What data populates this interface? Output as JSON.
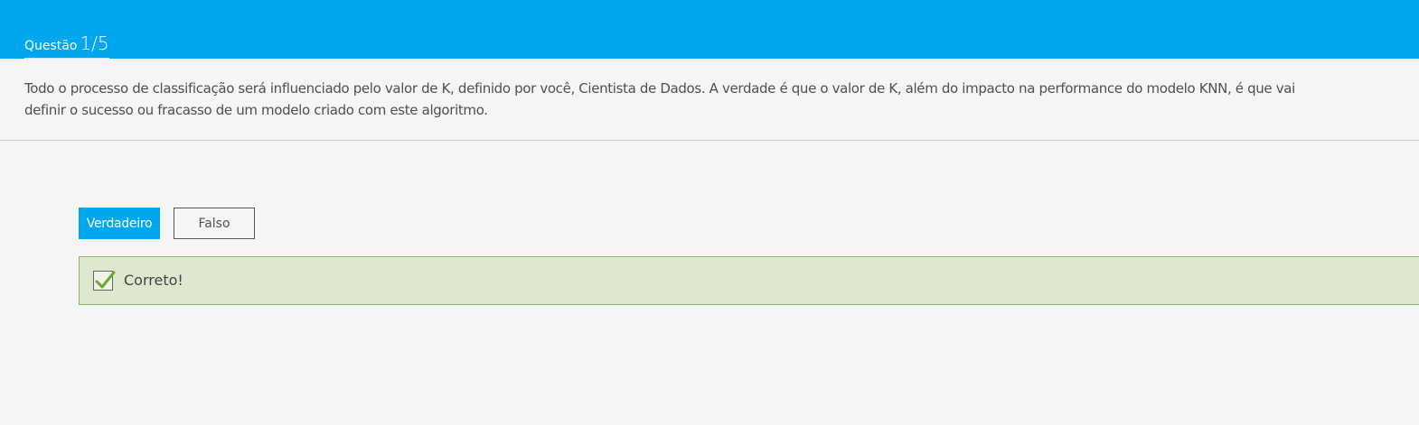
{
  "header": {
    "label": "Questão",
    "count": "1/5",
    "background_color": "#00a6ee"
  },
  "question": {
    "text": "Todo o processo de classificação será influenciado pelo valor de K, definido por você, Cientista de Dados. A verdade é que o valor de K, além do impacto na performance do modelo KNN, é que vai definir o sucesso ou fracasso de um modelo criado com este algoritmo."
  },
  "options": {
    "true_label": "Verdadeiro",
    "false_label": "Falso",
    "selected": "Verdadeiro"
  },
  "feedback": {
    "text": "Correto!",
    "icon": "checkmark-icon",
    "background_color": "#dde8cf",
    "border_color": "#8db36b"
  }
}
